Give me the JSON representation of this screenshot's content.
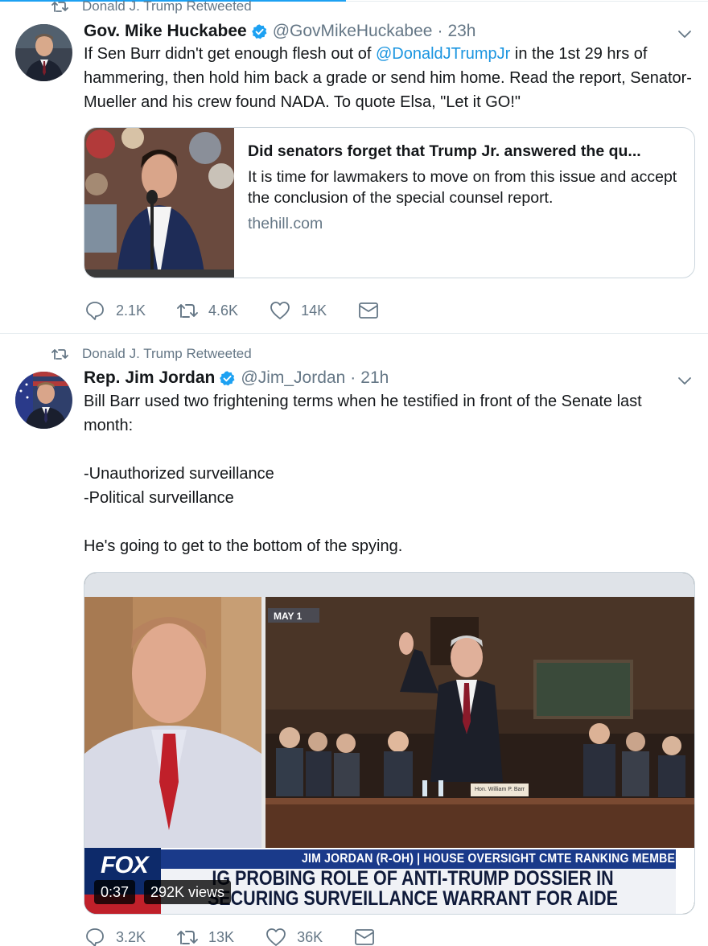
{
  "colors": {
    "accent": "#1da1f2",
    "link": "#1b95e0",
    "muted": "#657786",
    "border": "#ccd6dd"
  },
  "tweets": [
    {
      "retweeted_by": "Donald J. Trump Retweeted",
      "name": "Gov. Mike Huckabee",
      "handle": "@GovMikeHuckabee",
      "separator": "·",
      "time": "23h",
      "text_before": "If Sen Burr didn't get enough flesh out of ",
      "mention": "@DonaldJTrumpJr",
      "text_after": " in the 1st 29 hrs of hammering, then hold him back a grade or send him home.  Read the report, Senator-Mueller and his crew found NADA.  To quote Elsa, \"Let it GO!\"",
      "card": {
        "title": "Did senators forget that Trump Jr. answered the qu...",
        "description": "It is time for lawmakers to move on from this issue and accept the conclusion of the special counsel report.",
        "domain": "thehill.com"
      },
      "actions": {
        "replies": "2.1K",
        "retweets": "4.6K",
        "likes": "14K"
      },
      "icons": [
        "retweet-icon",
        "verified-icon",
        "caret-down-icon",
        "reply-icon",
        "retweet-icon",
        "like-icon",
        "message-icon"
      ]
    },
    {
      "retweeted_by": "Donald J. Trump Retweeted",
      "name": "Rep. Jim Jordan",
      "handle": "@Jim_Jordan",
      "separator": "·",
      "time": "21h",
      "lines": [
        "Bill Barr used two frightening terms when he testified in front of the Senate last month:",
        "",
        "-Unauthorized surveillance",
        "-Political surveillance",
        "",
        "He's going to get to the bottom of the spying."
      ],
      "video": {
        "may_label": "MAY 1",
        "nameplate": "Hon. William P. Barr",
        "network": "FOX",
        "ticker_label": "JIM JORDAN (R-OH) | HOUSE OVERSIGHT CMTE RANKING MEMBER",
        "headline_line1": "IG PROBING ROLE OF ANTI-TRUMP DOSSIER IN",
        "headline_line2": "SECURING SURVEILLANCE WARRANT FOR AIDE",
        "duration": "0:37",
        "views": "292K views"
      },
      "actions": {
        "replies": "3.2K",
        "retweets": "13K",
        "likes": "36K"
      }
    }
  ]
}
